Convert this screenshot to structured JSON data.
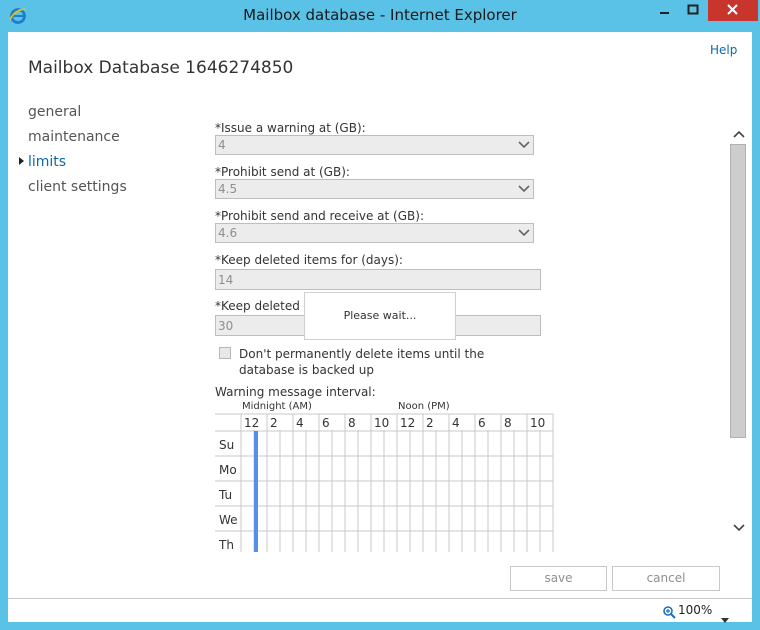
{
  "window": {
    "title": "Mailbox database - Internet Explorer"
  },
  "header": {
    "help_label": "Help",
    "page_title": "Mailbox Database 1646274850"
  },
  "nav": {
    "items": [
      {
        "label": "general",
        "active": false
      },
      {
        "label": "maintenance",
        "active": false
      },
      {
        "label": "limits",
        "active": true
      },
      {
        "label": "client settings",
        "active": false
      }
    ]
  },
  "form": {
    "warning": {
      "label": "*Issue a warning at (GB):",
      "value": "4"
    },
    "prohibit_send": {
      "label": "*Prohibit send at (GB):",
      "value": "4.5"
    },
    "prohibit_send_receive": {
      "label": "*Prohibit send and receive at (GB):",
      "value": "4.6"
    },
    "keep_deleted_items": {
      "label": "*Keep deleted items for (days):",
      "value": "14"
    },
    "keep_deleted_mailboxes": {
      "label": "*Keep deleted m",
      "value": "30"
    },
    "backup_checkbox": {
      "label": "Don't permanently delete items until the database is backed up",
      "checked": false
    },
    "interval": {
      "label": "Warning message interval:",
      "am_label": "Midnight (AM)",
      "pm_label": "Noon (PM)",
      "hours": [
        "12",
        "2",
        "4",
        "6",
        "8",
        "10",
        "12",
        "2",
        "4",
        "6",
        "8",
        "10"
      ],
      "days": [
        "Su",
        "Mo",
        "Tu",
        "We",
        "Th"
      ],
      "selected_color": "#5b8ee6"
    }
  },
  "popup": {
    "text": "Please wait..."
  },
  "footer": {
    "save_label": "save",
    "cancel_label": "cancel"
  },
  "statusbar": {
    "zoom": "100%"
  },
  "colors": {
    "titlebar": "#5bc2e7",
    "close": "#c7352c",
    "accent": "#0a6ba4"
  }
}
